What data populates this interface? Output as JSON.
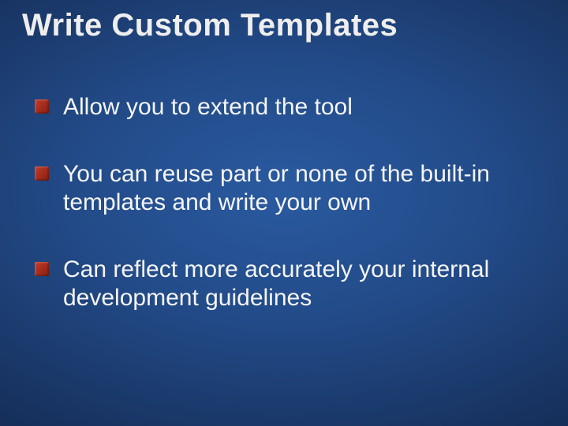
{
  "slide": {
    "title": "Write Custom Templates",
    "bullets": [
      "Allow you to extend the tool",
      "You can reuse part or none of the built-in templates and write your own",
      "Can reflect more accurately your internal development guidelines"
    ]
  }
}
